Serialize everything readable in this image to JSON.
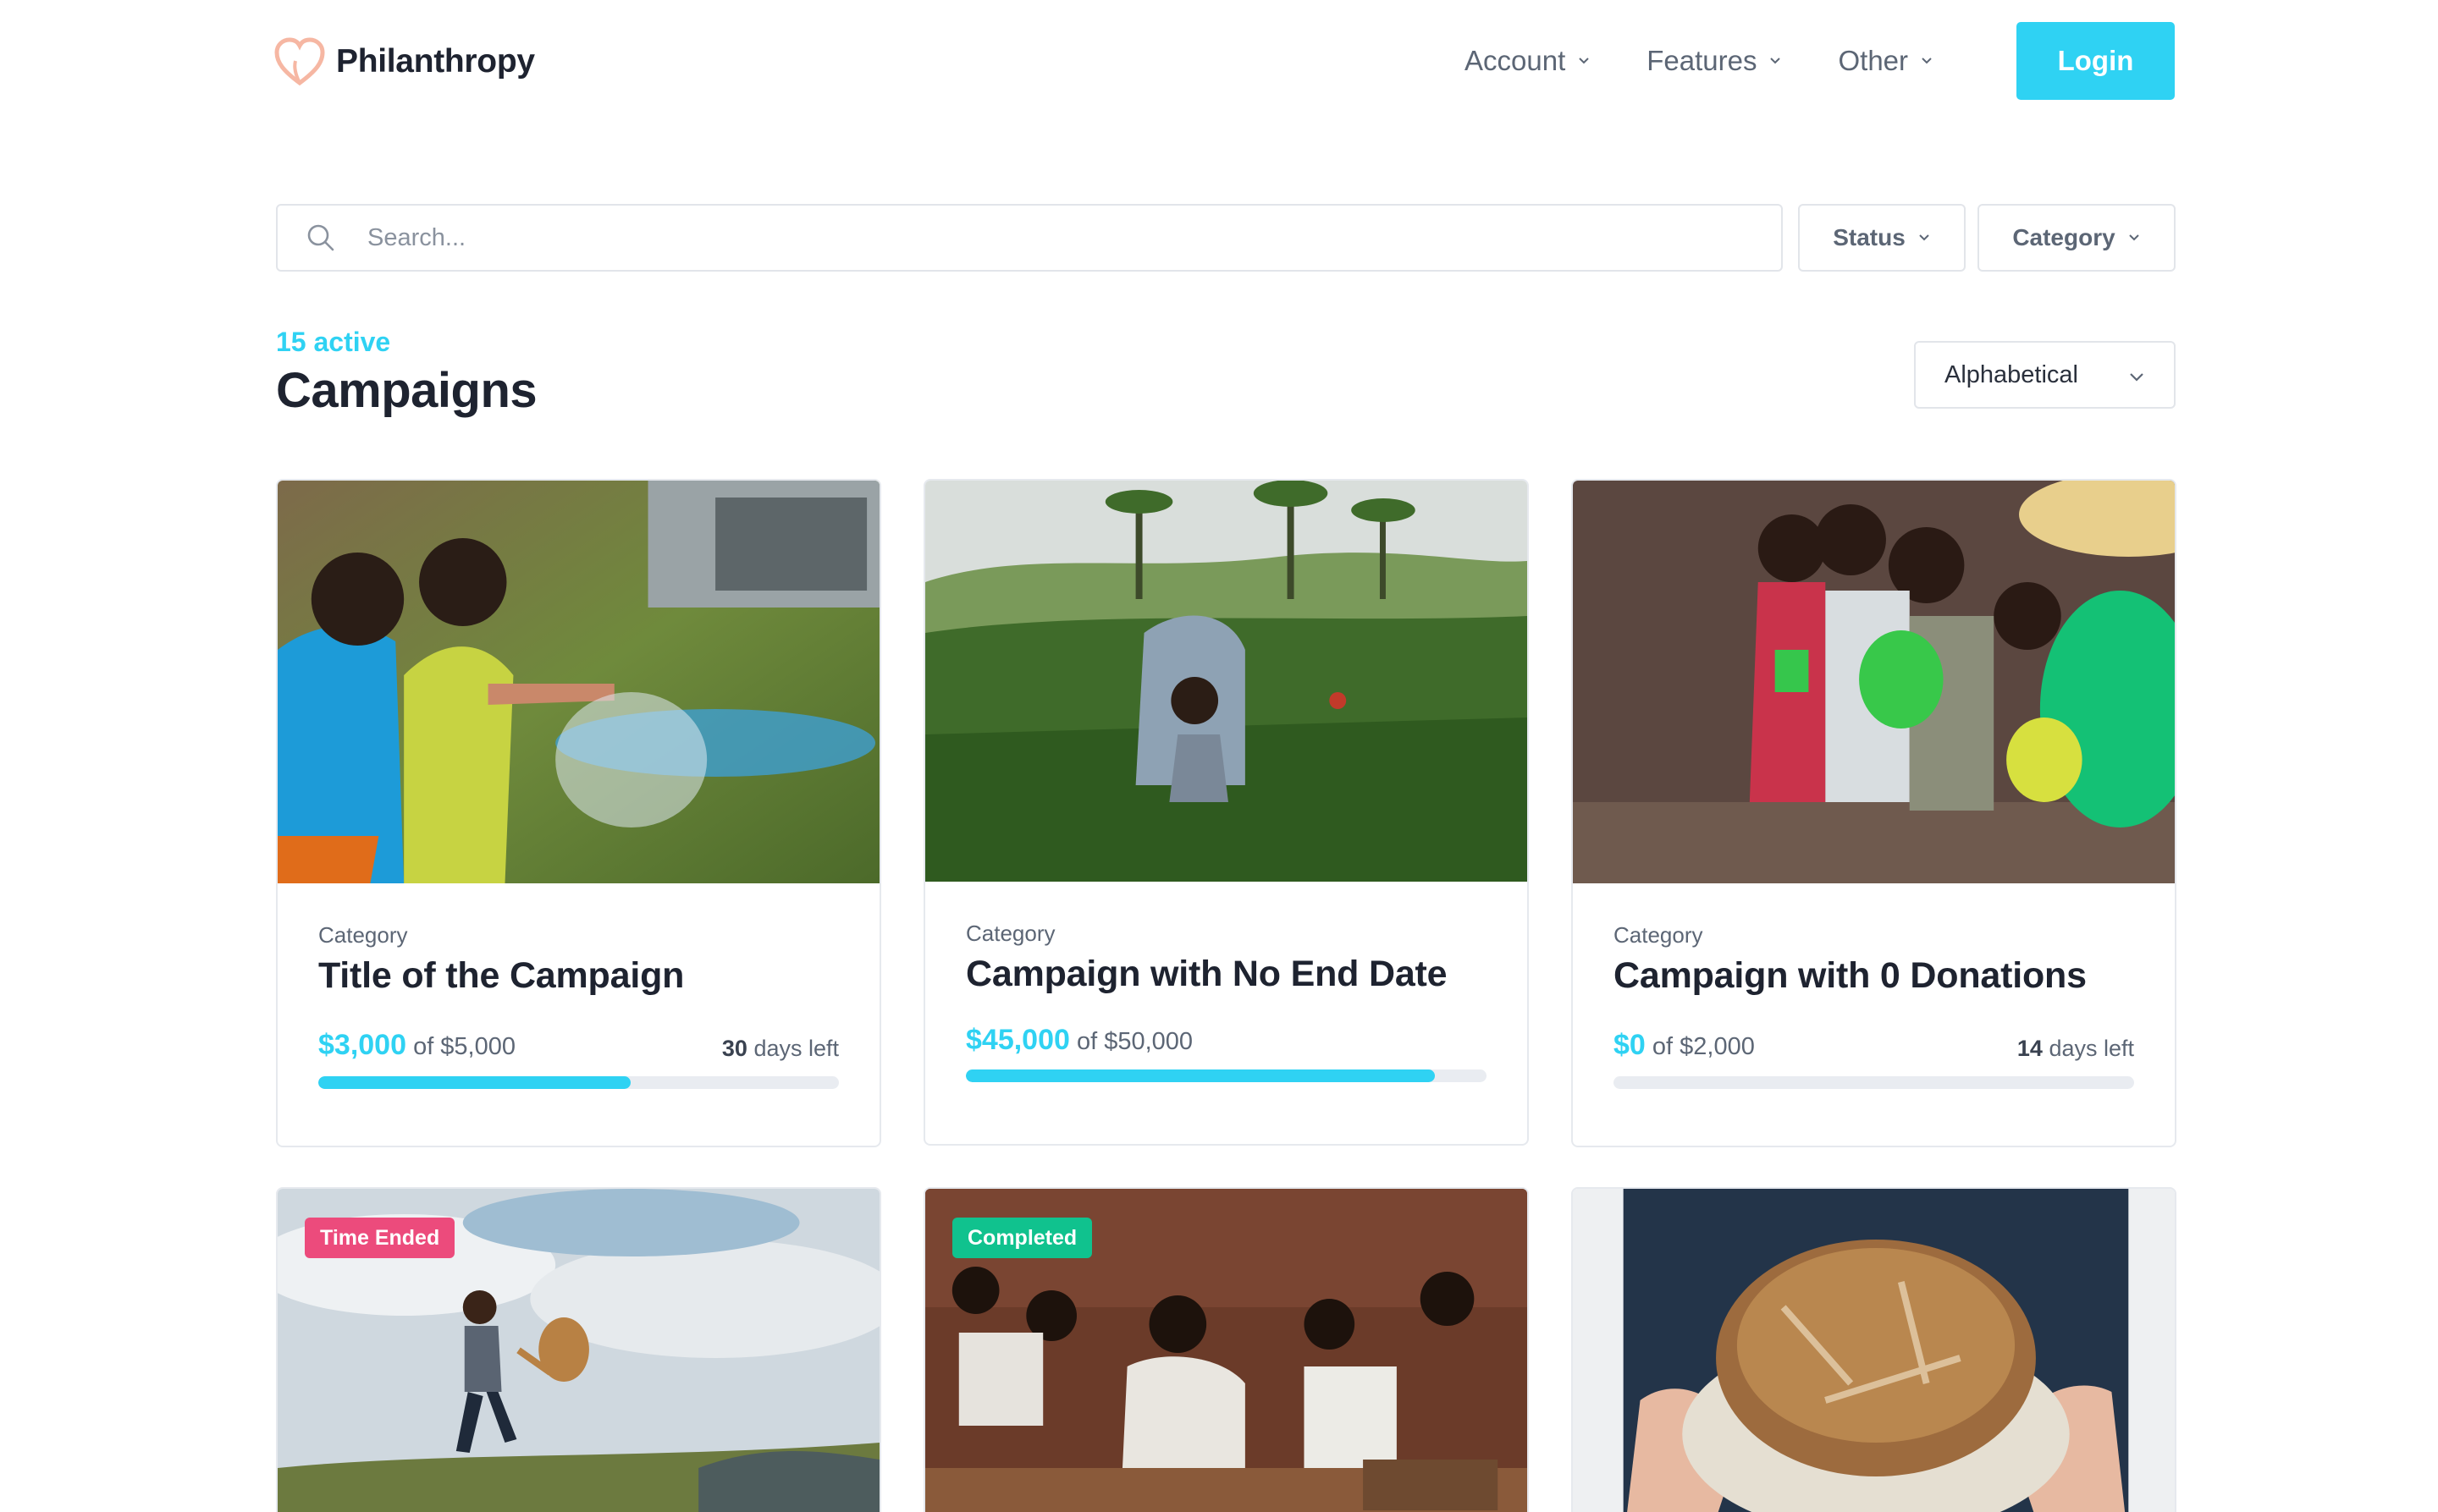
{
  "header": {
    "brand": "Philanthropy",
    "nav": [
      {
        "label": "Account"
      },
      {
        "label": "Features"
      },
      {
        "label": "Other"
      }
    ],
    "login_label": "Login"
  },
  "filters": {
    "search_placeholder": "Search...",
    "status_label": "Status",
    "category_label": "Category"
  },
  "listing": {
    "active_count": "15 active",
    "title": "Campaigns",
    "sort_value": "Alphabetical"
  },
  "cards": [
    {
      "category": "Category",
      "title": "Title of the Campaign",
      "raised": "$3,000",
      "goal_text": "of $5,000",
      "days_num": "30",
      "days_suffix": " days left",
      "progress": 0.6
    },
    {
      "category": "Category",
      "title": "Campaign with No End Date",
      "raised": "$45,000",
      "goal_text": "of $50,000",
      "days_num": "",
      "days_suffix": "",
      "progress": 0.9
    },
    {
      "category": "Category",
      "title": "Campaign with 0 Donations",
      "raised": "$0",
      "goal_text": "of $2,000",
      "days_num": "14",
      "days_suffix": " days left",
      "progress": 0.0
    },
    {
      "badge": "Time Ended",
      "badge_color": "#ec4b7c"
    },
    {
      "badge": "Completed",
      "badge_color": "#10c28e"
    },
    {}
  ],
  "colors": {
    "accent": "#2fd2f3",
    "badge_time_ended": "#ec4b7c",
    "badge_completed": "#10c28e"
  }
}
